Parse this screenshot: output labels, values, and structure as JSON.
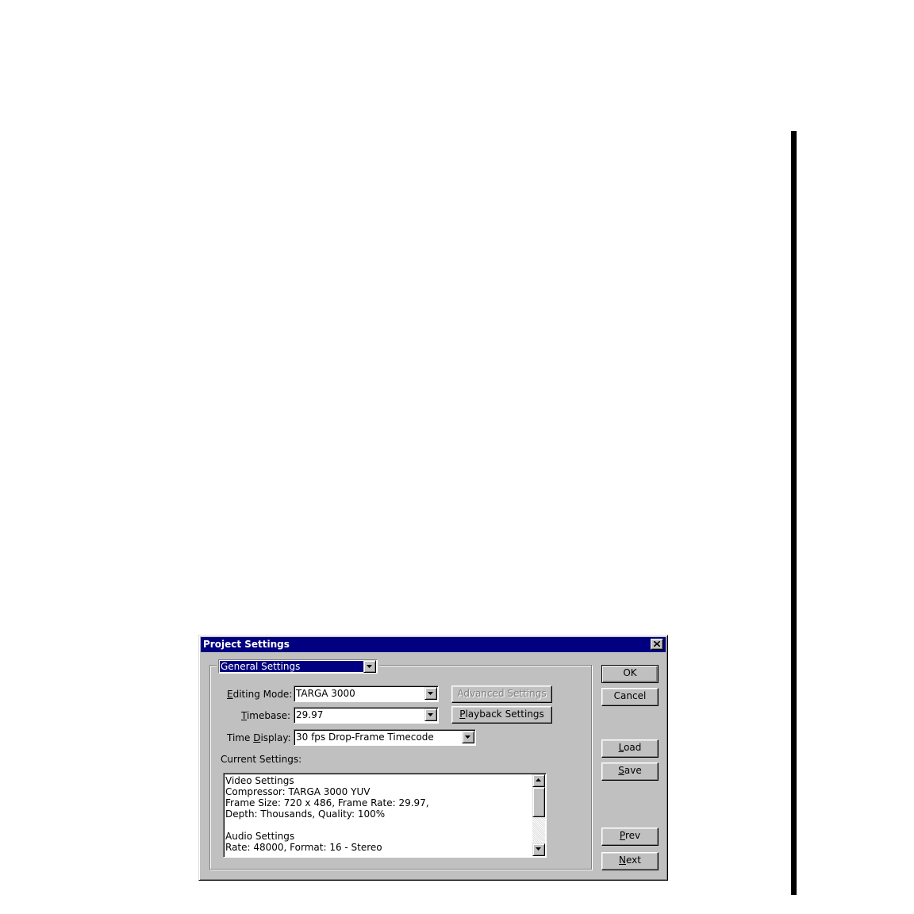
{
  "dialog": {
    "title": "Project Settings",
    "section": {
      "selected": "General Settings"
    },
    "fields": {
      "editing_mode": {
        "label_pre": "",
        "label_u": "E",
        "label_post": "diting Mode:",
        "value": "TARGA 3000"
      },
      "timebase": {
        "label_pre": "",
        "label_u": "T",
        "label_post": "imebase:",
        "value": "29.97"
      },
      "time_display": {
        "label_pre": "Time ",
        "label_u": "D",
        "label_post": "isplay:",
        "value": "30 fps Drop-Frame Timecode"
      }
    },
    "buttons": {
      "advanced_settings": "Advanced Settings",
      "playback_settings_u": "P",
      "playback_settings_rest": "layback Settings",
      "ok": "OK",
      "cancel": "Cancel",
      "load_u": "L",
      "load_rest": "oad",
      "save_u": "S",
      "save_rest": "ave",
      "prev_u": "P",
      "prev_rest": "rev",
      "next_u": "N",
      "next_rest": "ext"
    },
    "current_settings": {
      "label": "Current Settings:",
      "lines": [
        "Video Settings",
        "Compressor: TARGA 3000 YUV",
        "Frame Size: 720 x 486, Frame Rate: 29.97,",
        "Depth: Thousands, Quality: 100%",
        "",
        "Audio Settings",
        "Rate: 48000, Format: 16 - Stereo"
      ]
    }
  }
}
